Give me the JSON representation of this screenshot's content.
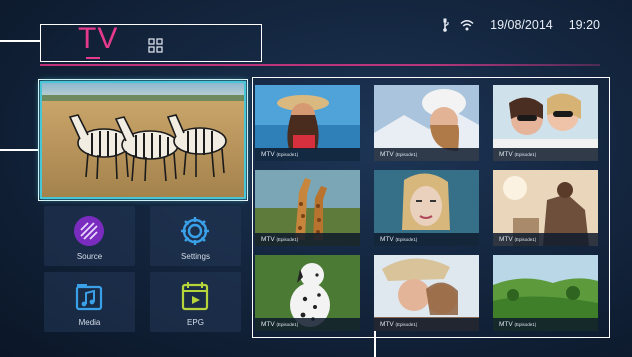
{
  "header": {
    "title": "TV",
    "grid_icon": "grid-view-icon",
    "date": "19/08/2014",
    "time": "19:20",
    "usb_icon": "usb-icon",
    "wifi_icon": "wifi-icon"
  },
  "colors": {
    "accent_pink": "#e63a8c",
    "focus_cyan": "#48c6d6",
    "background": "#14263f"
  },
  "featured": {
    "image": "zebras-on-savanna"
  },
  "tiles": [
    {
      "label": "Source",
      "icon": "source-icon"
    },
    {
      "label": "Settings",
      "icon": "settings-gear-icon"
    },
    {
      "label": "Media",
      "icon": "media-music-icon"
    },
    {
      "label": "EPG",
      "icon": "epg-icon"
    }
  ],
  "channels": [
    {
      "caption_main": "MTV",
      "caption_sub": "(Episode1)",
      "image": "woman-with-hat-beach"
    },
    {
      "caption_main": "MTV",
      "caption_sub": "(Episode1)",
      "image": "woman-in-snow-hat"
    },
    {
      "caption_main": "MTV",
      "caption_sub": "(Episode1)",
      "image": "two-women-sunglasses"
    },
    {
      "caption_main": "MTV",
      "caption_sub": "(Episode1)",
      "image": "giraffes"
    },
    {
      "caption_main": "MTV",
      "caption_sub": "(Episode1)",
      "image": "woman-portrait"
    },
    {
      "caption_main": "MTV",
      "caption_sub": "(Episode1)",
      "image": "person-sunset"
    },
    {
      "caption_main": "MTV",
      "caption_sub": "(Episode1)",
      "image": "dalmatian-dog"
    },
    {
      "caption_main": "MTV",
      "caption_sub": "(Episode1)",
      "image": "two-women-smiling"
    },
    {
      "caption_main": "MTV",
      "caption_sub": "(Episode1)",
      "image": "green-landscape"
    }
  ]
}
